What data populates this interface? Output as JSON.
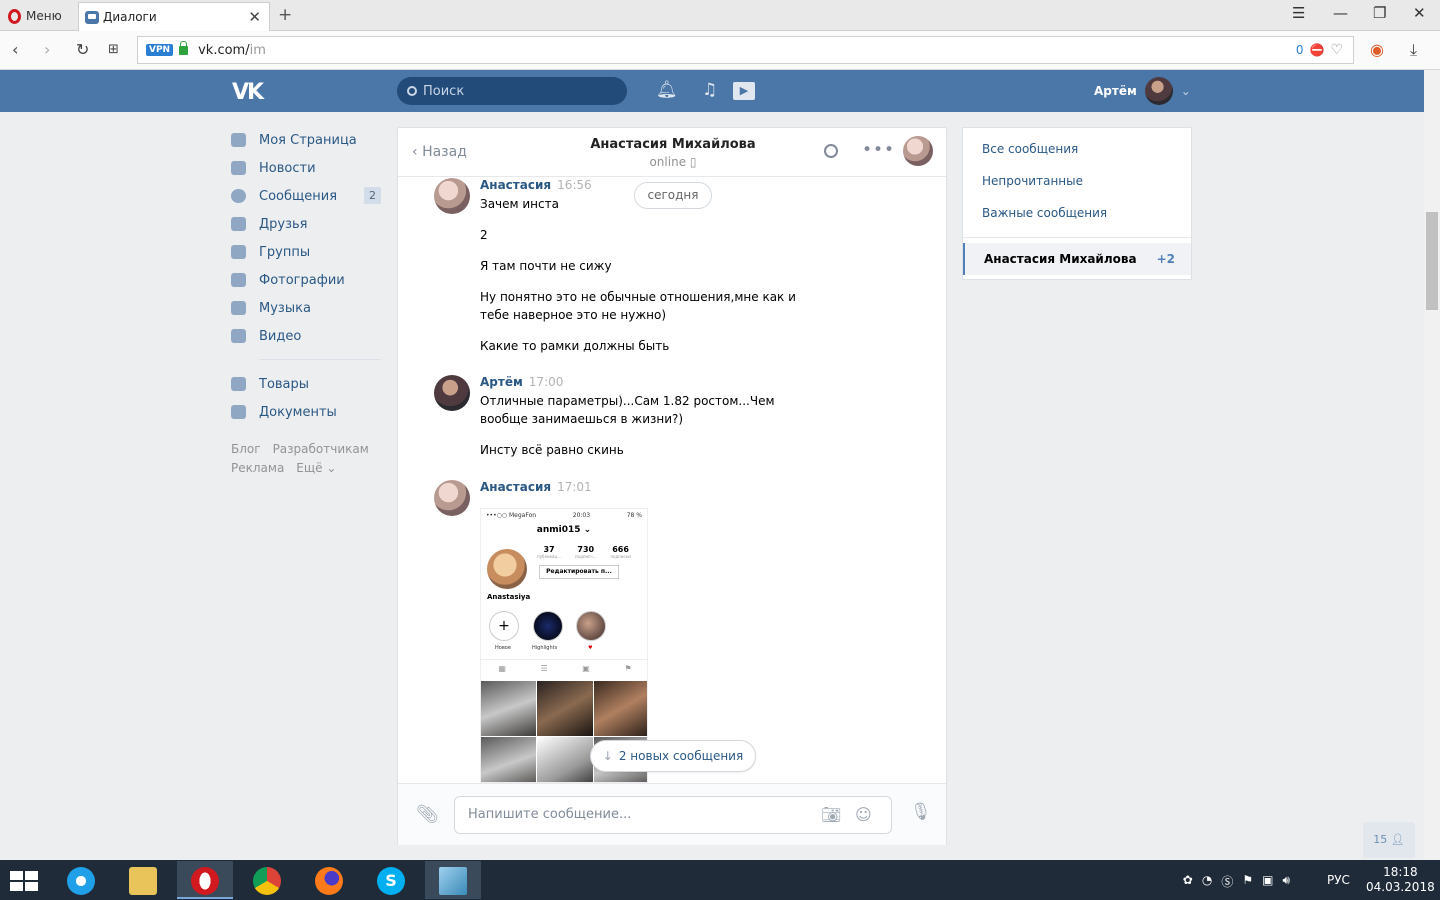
{
  "browser": {
    "menu_label": "Меню",
    "tab_title": "Диалоги",
    "url_host": "vk.com/",
    "url_path": "im",
    "vpn_label": "VPN",
    "adblock_count": "0"
  },
  "header": {
    "logo": "VK",
    "search_placeholder": "Поиск",
    "user_name": "Артём"
  },
  "sidebar": {
    "items": [
      {
        "label": "Моя Страница",
        "icon": "home-icon"
      },
      {
        "label": "Новости",
        "icon": "news-icon"
      },
      {
        "label": "Сообщения",
        "icon": "messages-icon",
        "count": "2"
      },
      {
        "label": "Друзья",
        "icon": "friends-icon"
      },
      {
        "label": "Группы",
        "icon": "groups-icon"
      },
      {
        "label": "Фотографии",
        "icon": "camera-icon"
      },
      {
        "label": "Музыка",
        "icon": "music-icon"
      },
      {
        "label": "Видео",
        "icon": "video-icon"
      }
    ],
    "items2": [
      {
        "label": "Товары",
        "icon": "shop-icon"
      },
      {
        "label": "Документы",
        "icon": "document-icon"
      }
    ],
    "footer": {
      "blog": "Блог",
      "devs": "Разработчикам",
      "ads": "Реклама",
      "more": "Ещё"
    }
  },
  "chat": {
    "back_label": "Назад",
    "peer_name": "Анастасия Михайлова",
    "peer_status": "online",
    "today_label": "сегодня",
    "groups": [
      {
        "author": "Анастасия",
        "time": "16:56",
        "lines": [
          "Зачем инста",
          "2",
          "Я там почти не сижу",
          "Ну понятно это не обычные отношения,мне как и тебе наверное это не нужно)",
          "Какие то рамки должны быть"
        ]
      },
      {
        "author": "Артём",
        "time": "17:00",
        "lines": [
          "Отличные параметры)...Сам 1.82 ростом...Чем вообще занимаешься в жизни?)",
          "Инсту всё равно скинь"
        ]
      },
      {
        "author": "Анастасия",
        "time": "17:01"
      }
    ],
    "screenshot": {
      "carrier": "•••○○ MegaFon",
      "clock": "20:03",
      "battery": "78 %",
      "username": "anmi015",
      "posts": "37",
      "followers": "730",
      "following": "666",
      "posts_label": "публикац...",
      "followers_label": "подписч...",
      "following_label": "подписки",
      "edit_label": "Редактировать п...",
      "display_name": "Anastasiya",
      "hl1": "Новое",
      "hl2": "Highlights"
    },
    "new_messages": "2 новых сообщения",
    "input_placeholder": "Напишите сообщение..."
  },
  "right_menu": {
    "all": "Все сообщения",
    "unread": "Непрочитанные",
    "important": "Важные сообщения",
    "active_dialog": "Анастасия Михайлова",
    "active_count": "+2"
  },
  "online_count": "15",
  "taskbar": {
    "lang": "РУС",
    "time": "18:18",
    "date": "04.03.2018"
  },
  "colors": {
    "vk_blue": "#4a76a8",
    "link": "#2a5885",
    "taskbar": "#1f2b38"
  }
}
